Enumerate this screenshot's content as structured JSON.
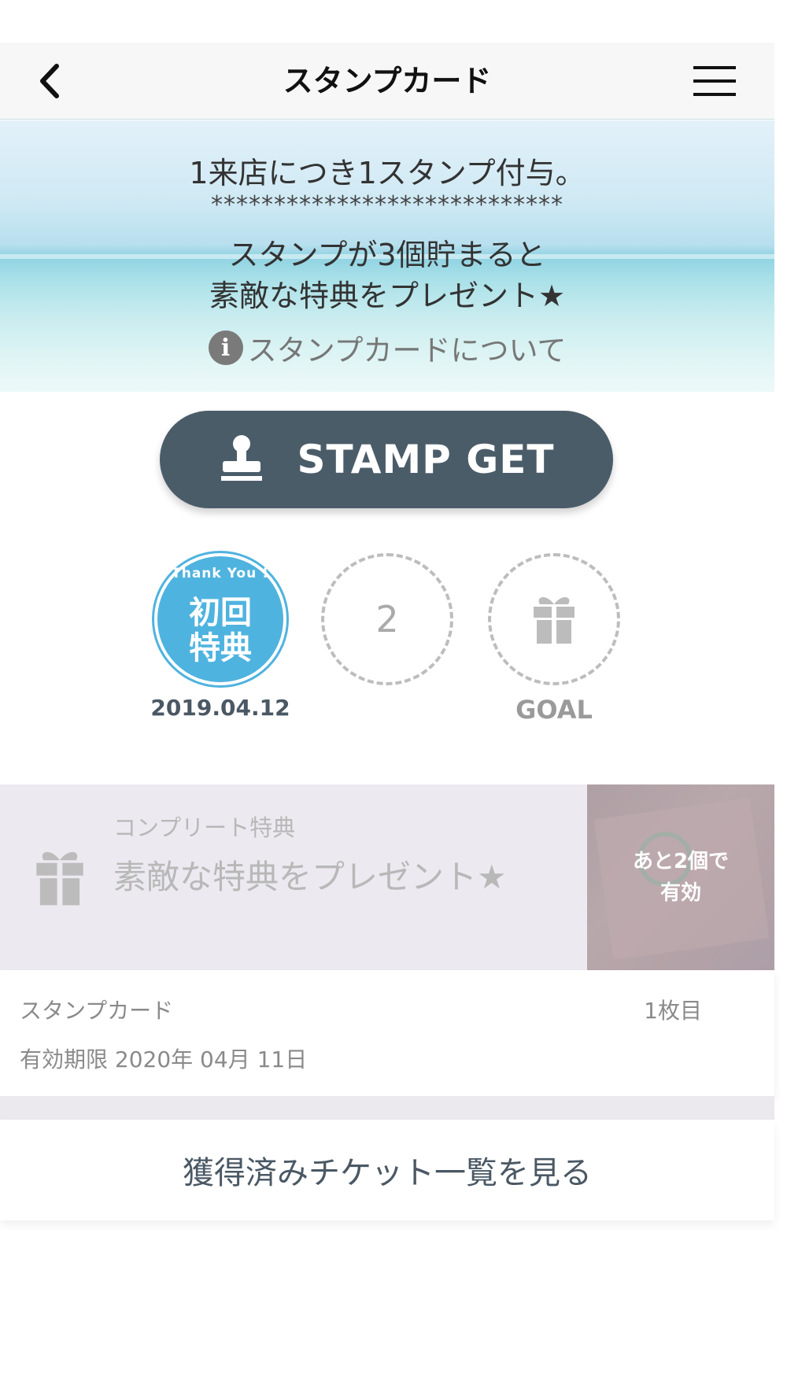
{
  "header": {
    "title": "スタンプカード",
    "back_icon": "chevron-left-icon",
    "menu_icon": "hamburger-menu-icon"
  },
  "hero": {
    "line1": "1来店につき1スタンプ付与。",
    "stars": "****************************",
    "line2": "スタンプが3個貯まると",
    "line3": "素敵な特典をプレゼント★",
    "about_link": "スタンプカードについて",
    "about_icon": "info-icon"
  },
  "stamp_button": {
    "label": "STAMP GET",
    "icon": "stamp-icon"
  },
  "stamps": {
    "slot1": {
      "badge_top": "Thank You !",
      "badge_line1": "初回",
      "badge_line2": "特典",
      "date": "2019.04.12"
    },
    "slot2": {
      "number": "2"
    },
    "slot3": {
      "icon": "gift-icon",
      "caption": "GOAL"
    }
  },
  "reward": {
    "subtitle": "コンプリート特典",
    "title": "素敵な特典をプレゼント★",
    "status_line1": "あと2個で",
    "status_line2": "有効",
    "icon": "gift-icon"
  },
  "card_info": {
    "label": "スタンプカード",
    "count": "1枚目",
    "expiry": "有効期限 2020年 04月 11日"
  },
  "tickets_button": {
    "label": "獲得済みチケット一覧を見る"
  },
  "colors": {
    "button_bg": "#4b5c69",
    "stamp_blue": "#4fb3df",
    "nav_bg": "#f7f7f7",
    "reward_bg": "#eceaf0"
  }
}
